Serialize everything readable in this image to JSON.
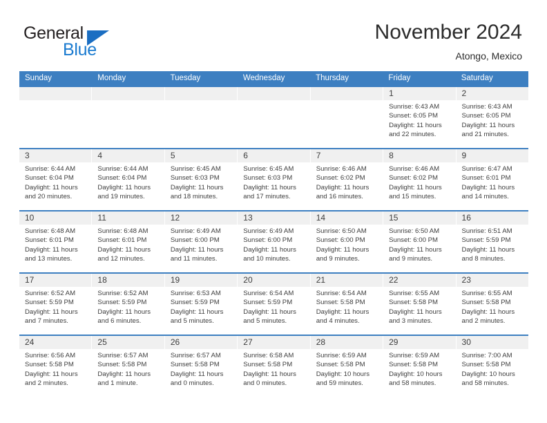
{
  "brand": {
    "name_part1": "General",
    "name_part2": "Blue",
    "accent_color": "#1b7bd0"
  },
  "header": {
    "title": "November 2024",
    "subtitle": "Atongo, Mexico"
  },
  "calendar": {
    "header_color": "#3d7fc1",
    "weekdays": [
      "Sunday",
      "Monday",
      "Tuesday",
      "Wednesday",
      "Thursday",
      "Friday",
      "Saturday"
    ],
    "weeks": [
      [
        {
          "day": "",
          "sunrise": "",
          "sunset": "",
          "daylight": "",
          "empty": true
        },
        {
          "day": "",
          "sunrise": "",
          "sunset": "",
          "daylight": "",
          "empty": true
        },
        {
          "day": "",
          "sunrise": "",
          "sunset": "",
          "daylight": "",
          "empty": true
        },
        {
          "day": "",
          "sunrise": "",
          "sunset": "",
          "daylight": "",
          "empty": true
        },
        {
          "day": "",
          "sunrise": "",
          "sunset": "",
          "daylight": "",
          "empty": true
        },
        {
          "day": "1",
          "sunrise": "Sunrise: 6:43 AM",
          "sunset": "Sunset: 6:05 PM",
          "daylight": "Daylight: 11 hours and 22 minutes."
        },
        {
          "day": "2",
          "sunrise": "Sunrise: 6:43 AM",
          "sunset": "Sunset: 6:05 PM",
          "daylight": "Daylight: 11 hours and 21 minutes."
        }
      ],
      [
        {
          "day": "3",
          "sunrise": "Sunrise: 6:44 AM",
          "sunset": "Sunset: 6:04 PM",
          "daylight": "Daylight: 11 hours and 20 minutes."
        },
        {
          "day": "4",
          "sunrise": "Sunrise: 6:44 AM",
          "sunset": "Sunset: 6:04 PM",
          "daylight": "Daylight: 11 hours and 19 minutes."
        },
        {
          "day": "5",
          "sunrise": "Sunrise: 6:45 AM",
          "sunset": "Sunset: 6:03 PM",
          "daylight": "Daylight: 11 hours and 18 minutes."
        },
        {
          "day": "6",
          "sunrise": "Sunrise: 6:45 AM",
          "sunset": "Sunset: 6:03 PM",
          "daylight": "Daylight: 11 hours and 17 minutes."
        },
        {
          "day": "7",
          "sunrise": "Sunrise: 6:46 AM",
          "sunset": "Sunset: 6:02 PM",
          "daylight": "Daylight: 11 hours and 16 minutes."
        },
        {
          "day": "8",
          "sunrise": "Sunrise: 6:46 AM",
          "sunset": "Sunset: 6:02 PM",
          "daylight": "Daylight: 11 hours and 15 minutes."
        },
        {
          "day": "9",
          "sunrise": "Sunrise: 6:47 AM",
          "sunset": "Sunset: 6:01 PM",
          "daylight": "Daylight: 11 hours and 14 minutes."
        }
      ],
      [
        {
          "day": "10",
          "sunrise": "Sunrise: 6:48 AM",
          "sunset": "Sunset: 6:01 PM",
          "daylight": "Daylight: 11 hours and 13 minutes."
        },
        {
          "day": "11",
          "sunrise": "Sunrise: 6:48 AM",
          "sunset": "Sunset: 6:01 PM",
          "daylight": "Daylight: 11 hours and 12 minutes."
        },
        {
          "day": "12",
          "sunrise": "Sunrise: 6:49 AM",
          "sunset": "Sunset: 6:00 PM",
          "daylight": "Daylight: 11 hours and 11 minutes."
        },
        {
          "day": "13",
          "sunrise": "Sunrise: 6:49 AM",
          "sunset": "Sunset: 6:00 PM",
          "daylight": "Daylight: 11 hours and 10 minutes."
        },
        {
          "day": "14",
          "sunrise": "Sunrise: 6:50 AM",
          "sunset": "Sunset: 6:00 PM",
          "daylight": "Daylight: 11 hours and 9 minutes."
        },
        {
          "day": "15",
          "sunrise": "Sunrise: 6:50 AM",
          "sunset": "Sunset: 6:00 PM",
          "daylight": "Daylight: 11 hours and 9 minutes."
        },
        {
          "day": "16",
          "sunrise": "Sunrise: 6:51 AM",
          "sunset": "Sunset: 5:59 PM",
          "daylight": "Daylight: 11 hours and 8 minutes."
        }
      ],
      [
        {
          "day": "17",
          "sunrise": "Sunrise: 6:52 AM",
          "sunset": "Sunset: 5:59 PM",
          "daylight": "Daylight: 11 hours and 7 minutes."
        },
        {
          "day": "18",
          "sunrise": "Sunrise: 6:52 AM",
          "sunset": "Sunset: 5:59 PM",
          "daylight": "Daylight: 11 hours and 6 minutes."
        },
        {
          "day": "19",
          "sunrise": "Sunrise: 6:53 AM",
          "sunset": "Sunset: 5:59 PM",
          "daylight": "Daylight: 11 hours and 5 minutes."
        },
        {
          "day": "20",
          "sunrise": "Sunrise: 6:54 AM",
          "sunset": "Sunset: 5:59 PM",
          "daylight": "Daylight: 11 hours and 5 minutes."
        },
        {
          "day": "21",
          "sunrise": "Sunrise: 6:54 AM",
          "sunset": "Sunset: 5:58 PM",
          "daylight": "Daylight: 11 hours and 4 minutes."
        },
        {
          "day": "22",
          "sunrise": "Sunrise: 6:55 AM",
          "sunset": "Sunset: 5:58 PM",
          "daylight": "Daylight: 11 hours and 3 minutes."
        },
        {
          "day": "23",
          "sunrise": "Sunrise: 6:55 AM",
          "sunset": "Sunset: 5:58 PM",
          "daylight": "Daylight: 11 hours and 2 minutes."
        }
      ],
      [
        {
          "day": "24",
          "sunrise": "Sunrise: 6:56 AM",
          "sunset": "Sunset: 5:58 PM",
          "daylight": "Daylight: 11 hours and 2 minutes."
        },
        {
          "day": "25",
          "sunrise": "Sunrise: 6:57 AM",
          "sunset": "Sunset: 5:58 PM",
          "daylight": "Daylight: 11 hours and 1 minute."
        },
        {
          "day": "26",
          "sunrise": "Sunrise: 6:57 AM",
          "sunset": "Sunset: 5:58 PM",
          "daylight": "Daylight: 11 hours and 0 minutes."
        },
        {
          "day": "27",
          "sunrise": "Sunrise: 6:58 AM",
          "sunset": "Sunset: 5:58 PM",
          "daylight": "Daylight: 11 hours and 0 minutes."
        },
        {
          "day": "28",
          "sunrise": "Sunrise: 6:59 AM",
          "sunset": "Sunset: 5:58 PM",
          "daylight": "Daylight: 10 hours and 59 minutes."
        },
        {
          "day": "29",
          "sunrise": "Sunrise: 6:59 AM",
          "sunset": "Sunset: 5:58 PM",
          "daylight": "Daylight: 10 hours and 58 minutes."
        },
        {
          "day": "30",
          "sunrise": "Sunrise: 7:00 AM",
          "sunset": "Sunset: 5:58 PM",
          "daylight": "Daylight: 10 hours and 58 minutes."
        }
      ]
    ]
  }
}
